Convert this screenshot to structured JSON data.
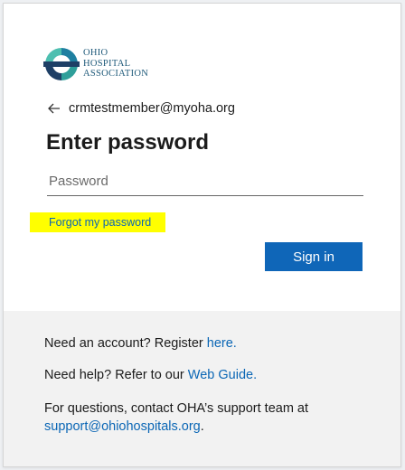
{
  "logo": {
    "line1": "Ohio",
    "line2": "Hospital",
    "line3": "Association",
    "colors": {
      "blue": "#1f5a7a",
      "teal": "#4dbfb0",
      "dark": "#1e3f66"
    }
  },
  "identity": {
    "back_icon": "arrow-left-icon",
    "email": "crmtestmember@myoha.org"
  },
  "form": {
    "title": "Enter password",
    "password_placeholder": "Password",
    "password_value": "",
    "forgot_link": "Forgot my password",
    "forgot_highlight_color": "#ffff00",
    "signin_label": "Sign in",
    "accent_color": "#0f66b8"
  },
  "footer": {
    "register_prefix": "Need an account? Register ",
    "register_link": "here.",
    "help_prefix": "Need help? Refer to our ",
    "help_link": "Web Guide.",
    "support_text": "For questions, contact OHA’s support team at",
    "support_email": "support@ohiohospitals.org",
    "support_suffix": "."
  }
}
